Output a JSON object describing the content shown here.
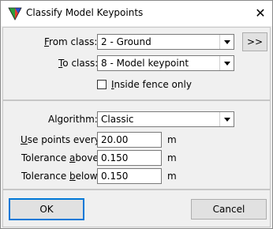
{
  "window": {
    "title": "Classify Model Keypoints",
    "close_glyph": "✕"
  },
  "classes": {
    "from_label_u": "F",
    "from_label_rest": "rom class:",
    "from_value": "2 - Ground",
    "more_button": ">>",
    "to_label_u": "T",
    "to_label_rest": "o class:",
    "to_value": "8 - Model keypoint",
    "inside_fence_u": "I",
    "inside_fence_rest": "nside fence only",
    "inside_fence_checked": false
  },
  "params": {
    "algorithm_label": "Algorithm:",
    "algorithm_value": "Classic",
    "use_points_u": "U",
    "use_points_rest": "se points every:",
    "use_points_value": "20.00",
    "use_points_unit": "m",
    "tol_above_pre": "Tolerance ",
    "tol_above_u": "a",
    "tol_above_post": "bove:",
    "tol_above_value": "0.150",
    "tol_above_unit": "m",
    "tol_below_pre": "Tolerance ",
    "tol_below_u": "b",
    "tol_below_post": "elow:",
    "tol_below_value": "0.150",
    "tol_below_unit": "m"
  },
  "footer": {
    "ok_label": "OK",
    "cancel_label": "Cancel"
  }
}
